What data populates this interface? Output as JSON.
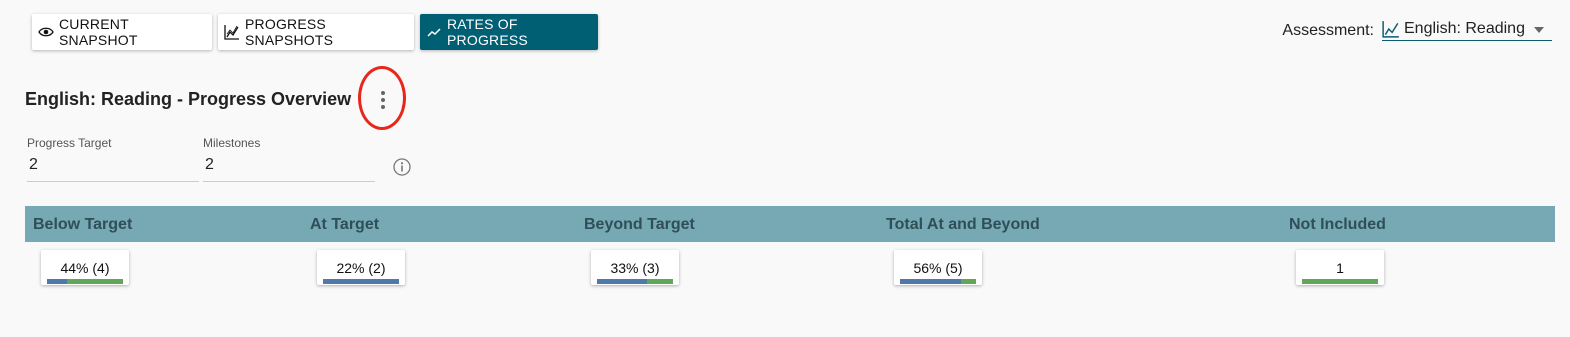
{
  "toolbar": {
    "buttons": [
      {
        "label": "CURRENT SNAPSHOT",
        "icon": "eye-icon"
      },
      {
        "label": "PROGRESS SNAPSHOTS",
        "icon": "chart-line-icon"
      },
      {
        "label": "RATES OF PROGRESS",
        "icon": "trending-up-icon"
      }
    ],
    "active_index": 2
  },
  "assessment": {
    "label": "Assessment:",
    "selected": "English: Reading",
    "icon": "chart-line-icon"
  },
  "overview": {
    "title": "English: Reading - Progress Overview"
  },
  "fields": {
    "progress_target": {
      "label": "Progress Target",
      "value": "2"
    },
    "milestones": {
      "label": "Milestones",
      "value": "2"
    }
  },
  "summary": {
    "columns": [
      {
        "header": "Below Target",
        "value": "44% (4)",
        "bar_blue": 0.26,
        "bar_green": 0.74
      },
      {
        "header": "At Target",
        "value": "22% (2)",
        "bar_blue": 1.0,
        "bar_green": 0.0
      },
      {
        "header": "Beyond Target",
        "value": "33% (3)",
        "bar_blue": 0.66,
        "bar_green": 0.34
      },
      {
        "header": "Total At and Beyond",
        "value": "56% (5)",
        "bar_blue": 0.8,
        "bar_green": 0.2
      },
      {
        "header": "Not Included",
        "value": "1",
        "bar_blue": 0.0,
        "bar_green": 1.0
      }
    ]
  },
  "colors": {
    "accent": "#005f73",
    "band": "#76a9b4",
    "bar_blue": "#4f79a8",
    "bar_green": "#5fa85a",
    "highlight": "#e8261a"
  }
}
